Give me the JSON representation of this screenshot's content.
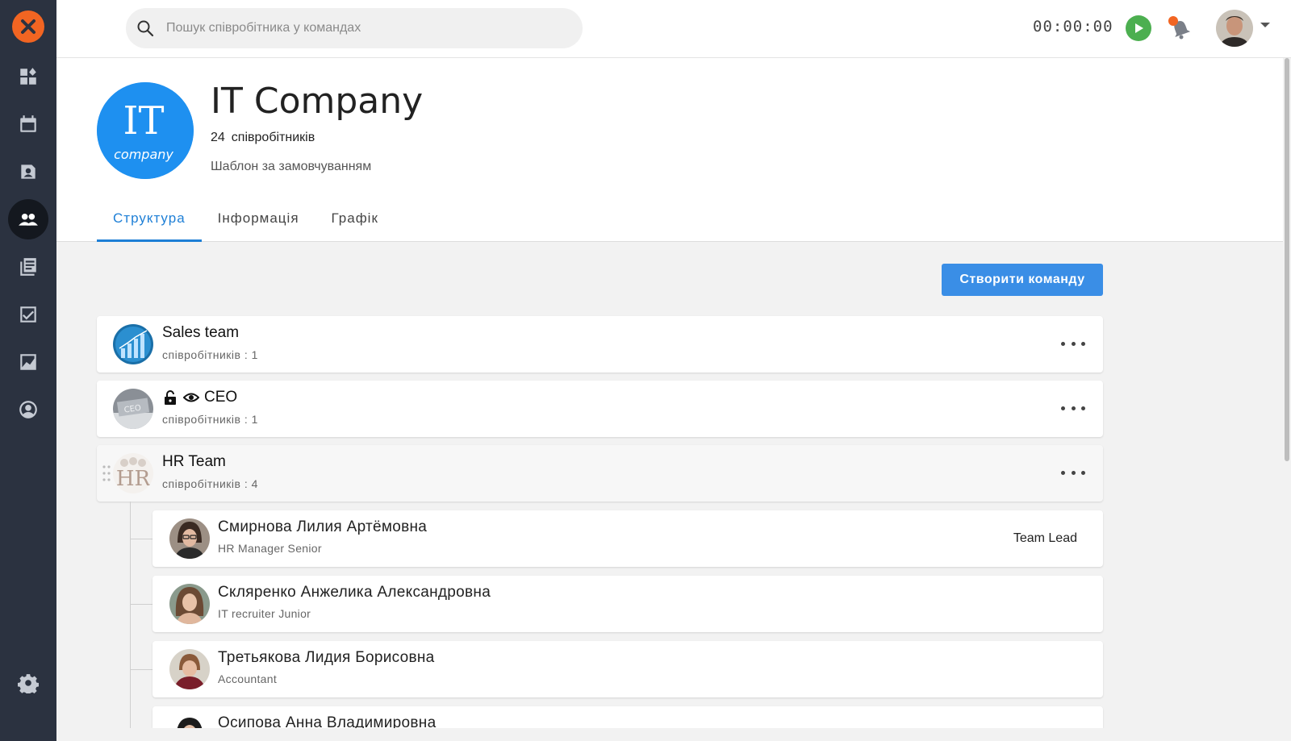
{
  "search": {
    "placeholder": "Пошук співробітника у командах"
  },
  "timer": {
    "value": "00:00:00"
  },
  "company": {
    "title": "IT Company",
    "employee_count": "24",
    "employee_label": "співробітників",
    "template": "Шаблон за замовчуванням",
    "logo_text_top": "IT",
    "logo_text_bottom": "company"
  },
  "tabs": [
    {
      "label": "Структура",
      "active": true
    },
    {
      "label": "Інформація",
      "active": false
    },
    {
      "label": "Графік",
      "active": false
    }
  ],
  "actions": {
    "create_team": "Створити команду"
  },
  "teams": [
    {
      "name": "Sales team",
      "sub": "співробітників : 1"
    },
    {
      "name": "CEO",
      "sub": "співробітників : 1"
    },
    {
      "name": "HR Team",
      "sub": "співробітників : 4",
      "avatar_text": "HR"
    }
  ],
  "members": [
    {
      "name": "Смирнова Лилия Артёмовна",
      "role": "HR Manager Senior",
      "badge": "Team Lead"
    },
    {
      "name": "Скляренко Анжелика Александровна",
      "role": "IT recruiter Junior"
    },
    {
      "name": "Третьякова Лидия Борисовна",
      "role": "Accountant"
    },
    {
      "name": "Осипова Анна Владимировна",
      "role": ""
    }
  ],
  "colors": {
    "accent": "#1e7fd6",
    "button": "#3a8ee6",
    "sidebar": "#2b3240",
    "brand": "#f26522",
    "play": "#4caf50"
  },
  "icons": [
    "logo-icon",
    "dashboard-icon",
    "calendar-icon",
    "contacts-icon",
    "teams-icon",
    "documents-icon",
    "tasks-icon",
    "analytics-icon",
    "profile-icon",
    "settings-icon",
    "search-icon",
    "play-icon",
    "bell-icon",
    "lock-icon",
    "eye-icon",
    "more-icon",
    "drag-handle-icon"
  ]
}
